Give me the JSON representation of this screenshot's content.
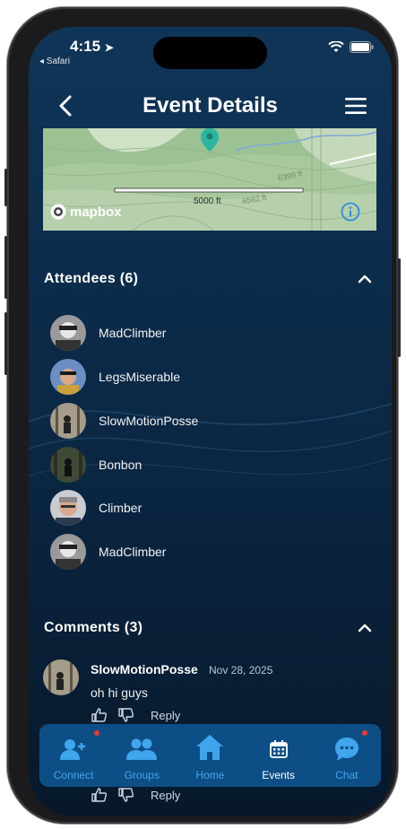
{
  "status": {
    "time": "4:15",
    "back_app": "◂ Safari"
  },
  "header": {
    "title": "Event Details"
  },
  "map": {
    "scale_label": "5000 ft",
    "attribution": "mapbox",
    "elev_1": "6399 ft",
    "elev_2": "6562 ft"
  },
  "attendees": {
    "title": "Attendees (6)",
    "items": [
      {
        "name": "MadClimber"
      },
      {
        "name": "LegsMiserable"
      },
      {
        "name": "SlowMotionPosse"
      },
      {
        "name": "Bonbon"
      },
      {
        "name": "Climber"
      },
      {
        "name": "MadClimber"
      }
    ]
  },
  "comments": {
    "title": "Comments (3)",
    "items": [
      {
        "user": "SlowMotionPosse",
        "date": "Nov 28, 2025",
        "text": "oh hi guys",
        "reply": "Reply"
      }
    ],
    "second_reply": "Reply"
  },
  "tabs": [
    {
      "label": "Connect",
      "icon": "connect-icon"
    },
    {
      "label": "Groups",
      "icon": "groups-icon"
    },
    {
      "label": "Home",
      "icon": "home-icon"
    },
    {
      "label": "Events",
      "icon": "calendar-icon"
    },
    {
      "label": "Chat",
      "icon": "chat-icon"
    }
  ],
  "colors": {
    "accent": "#3fa5ec",
    "tabbar": "#0e4e86",
    "badge": "#e53935",
    "pin": "#2bb5a0"
  }
}
